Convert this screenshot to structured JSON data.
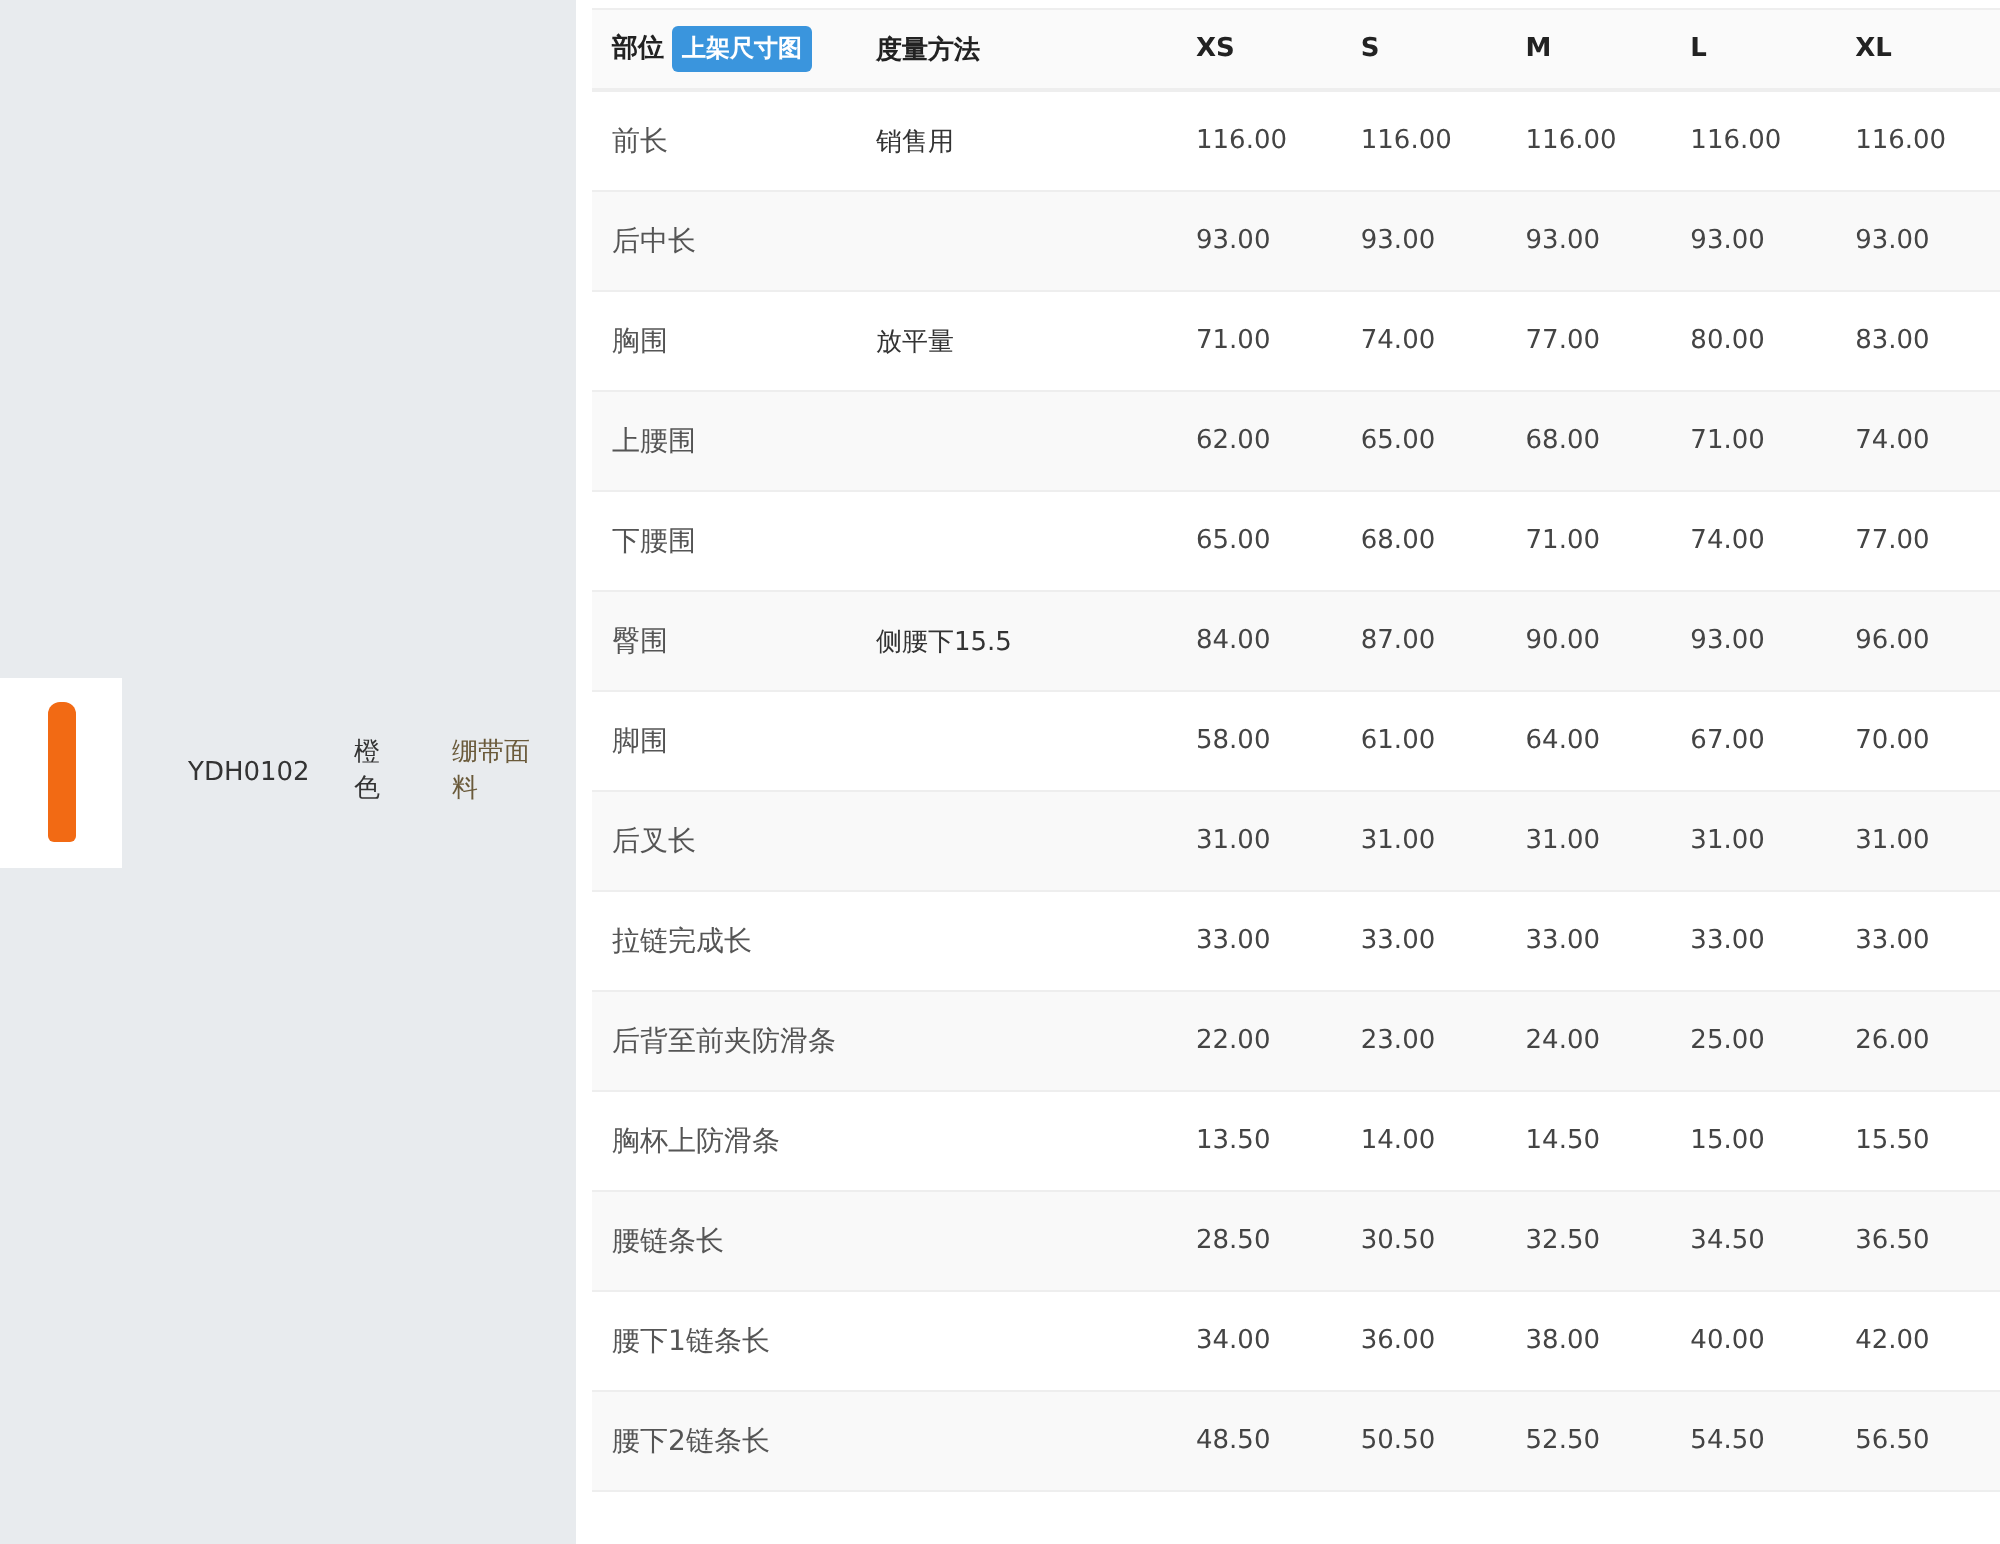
{
  "product": {
    "code": "YDH0102",
    "color_name": "橙色",
    "fabric": "绷带面料"
  },
  "table": {
    "columns": [
      "部位",
      "度量方法",
      "XS",
      "S",
      "M",
      "L",
      "XL"
    ],
    "badge": "上架尺寸图",
    "rows": [
      {
        "part": "前长",
        "method": "销售用",
        "values": [
          "116.00",
          "116.00",
          "116.00",
          "116.00",
          "116.00"
        ]
      },
      {
        "part": "后中长",
        "method": "",
        "values": [
          "93.00",
          "93.00",
          "93.00",
          "93.00",
          "93.00"
        ]
      },
      {
        "part": "胸围",
        "method": "放平量",
        "values": [
          "71.00",
          "74.00",
          "77.00",
          "80.00",
          "83.00"
        ]
      },
      {
        "part": "上腰围",
        "method": "",
        "values": [
          "62.00",
          "65.00",
          "68.00",
          "71.00",
          "74.00"
        ]
      },
      {
        "part": "下腰围",
        "method": "",
        "values": [
          "65.00",
          "68.00",
          "71.00",
          "74.00",
          "77.00"
        ]
      },
      {
        "part": "臀围",
        "method": "侧腰下15.5",
        "values": [
          "84.00",
          "87.00",
          "90.00",
          "93.00",
          "96.00"
        ]
      },
      {
        "part": "脚围",
        "method": "",
        "values": [
          "58.00",
          "61.00",
          "64.00",
          "67.00",
          "70.00"
        ]
      },
      {
        "part": "后叉长",
        "method": "",
        "values": [
          "31.00",
          "31.00",
          "31.00",
          "31.00",
          "31.00"
        ]
      },
      {
        "part": "拉链完成长",
        "method": "",
        "values": [
          "33.00",
          "33.00",
          "33.00",
          "33.00",
          "33.00"
        ]
      },
      {
        "part": "后背至前夹防滑条",
        "method": "",
        "values": [
          "22.00",
          "23.00",
          "24.00",
          "25.00",
          "26.00"
        ]
      },
      {
        "part": "胸杯上防滑条",
        "method": "",
        "values": [
          "13.50",
          "14.00",
          "14.50",
          "15.00",
          "15.50"
        ]
      },
      {
        "part": "腰链条长",
        "method": "",
        "values": [
          "28.50",
          "30.50",
          "32.50",
          "34.50",
          "36.50"
        ]
      },
      {
        "part": "腰下1链条长",
        "method": "",
        "values": [
          "34.00",
          "36.00",
          "38.00",
          "40.00",
          "42.00"
        ]
      },
      {
        "part": "腰下2链条长",
        "method": "",
        "values": [
          "48.50",
          "50.50",
          "52.50",
          "54.50",
          "56.50"
        ]
      }
    ]
  }
}
